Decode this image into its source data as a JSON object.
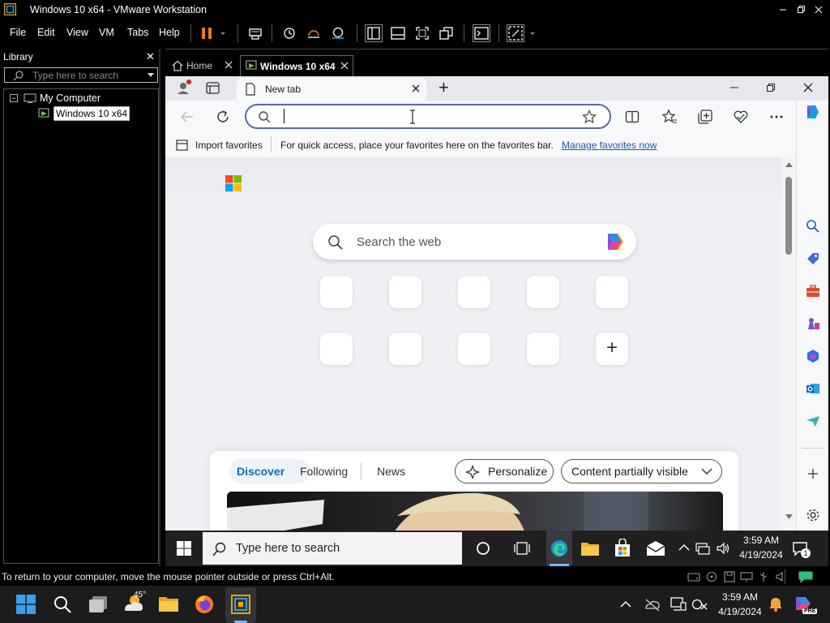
{
  "window": {
    "title": "Windows 10 x64 - VMware Workstation",
    "controls": [
      "minimize",
      "restore",
      "close"
    ]
  },
  "menu": {
    "items": [
      "File",
      "Edit",
      "View",
      "VM",
      "Tabs",
      "Help"
    ]
  },
  "library": {
    "title": "Library",
    "close_glyph": "✕",
    "search_placeholder": "Type here to search",
    "tree": {
      "root": "My Computer",
      "children": [
        "Windows 10 x64"
      ],
      "expander": "−"
    }
  },
  "vm_tabs": [
    {
      "label": "Home",
      "active": false
    },
    {
      "label": "Windows 10 x64",
      "active": true
    }
  ],
  "edge": {
    "tab_title": "New tab",
    "new_tab_glyph": "+",
    "address_value": "",
    "favorites_bar": {
      "import_label": "Import favorites",
      "message": "For quick access, place your favorites here on the favorites bar.",
      "manage_link": "Manage favorites now"
    },
    "web_search_placeholder": "Search the web",
    "add_tile_glyph": "+",
    "feed": {
      "tabs": [
        "Discover",
        "Following",
        "News"
      ],
      "active_tab": "Discover",
      "personalize_label": "Personalize",
      "content_label": "Content partially visible"
    },
    "accent": "#0f6cbd",
    "link_color": "#1a56b4"
  },
  "guest_taskbar": {
    "search_placeholder": "Type here to search",
    "time": "3:59 AM",
    "date": "4/19/2024",
    "notification_count": "1"
  },
  "status_bar": {
    "message": "To return to your computer, move the mouse pointer outside or press Ctrl+Alt."
  },
  "host_taskbar": {
    "weather_temp": "45°",
    "time": "3:59 AM",
    "date": "4/19/2024",
    "copilot_badge": "PRE"
  }
}
